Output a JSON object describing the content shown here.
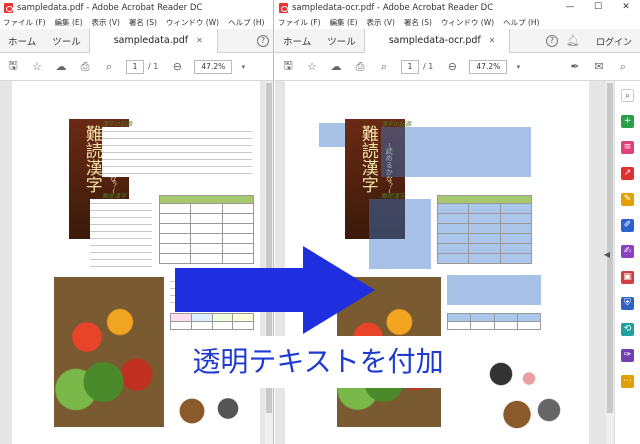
{
  "left_window": {
    "title": "sampledata.pdf - Adobe Acrobat Reader DC",
    "menu": [
      "ファイル (F)",
      "編集 (E)",
      "表示 (V)",
      "署名 (S)",
      "ウィンドウ (W)",
      "ヘルプ (H)"
    ],
    "nav": [
      "ホーム",
      "ツール"
    ],
    "tab_label": "sampledata.pdf",
    "page_current": "1",
    "page_total": "/ 1",
    "zoom": "47.2%"
  },
  "right_window": {
    "title": "sampledata-ocr.pdf - Adobe Acrobat Reader DC",
    "menu": [
      "ファイル (F)",
      "編集 (E)",
      "表示 (V)",
      "署名 (S)",
      "ウィンドウ (W)",
      "ヘルプ (H)"
    ],
    "nav": [
      "ホーム",
      "ツール"
    ],
    "tab_label": "sampledata-ocr.pdf",
    "login": "ログイン",
    "page_current": "1",
    "page_total": "/ 1",
    "zoom": "47.2%"
  },
  "document": {
    "banner_chars": "難読漢字",
    "banner_sub": "─読めるかな？─",
    "heading1": "漢字の起源",
    "heading2": "難読漢字"
  },
  "overlay": {
    "caption": "透明テキストを付加"
  },
  "colors": {
    "arrow": "#1f2fe0",
    "caption": "#1e3ad0",
    "ocr_highlight": "#3c78c8"
  }
}
